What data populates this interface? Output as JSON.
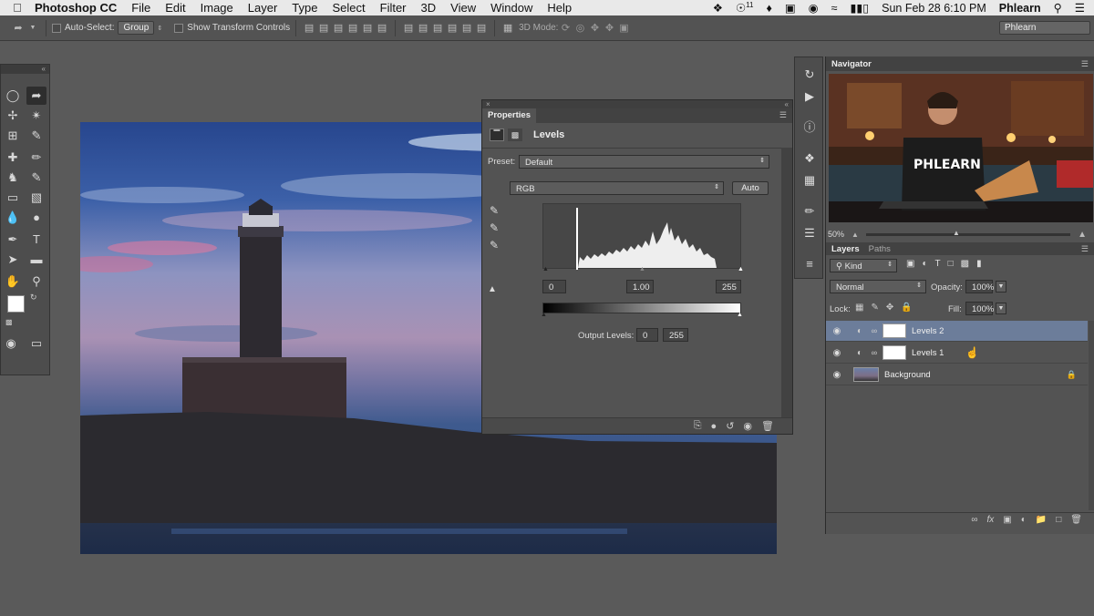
{
  "menubar": {
    "apple": "",
    "app_name": "Photoshop CC",
    "items": [
      "File",
      "Edit",
      "Image",
      "Layer",
      "Type",
      "Select",
      "Filter",
      "3D",
      "View",
      "Window",
      "Help"
    ],
    "status": {
      "notification_count": "11",
      "datetime": "Sun Feb 28  6:10 PM",
      "user": "Phlearn"
    }
  },
  "options_bar": {
    "auto_select_label": "Auto-Select:",
    "auto_select_value": "Group",
    "show_transform_label": "Show Transform Controls",
    "mode_3d_label": "3D Mode:",
    "workspace": "Phlearn"
  },
  "properties_panel": {
    "title": "Properties",
    "adjustment_name": "Levels",
    "preset_label": "Preset:",
    "preset_value": "Default",
    "channel_value": "RGB",
    "auto_label": "Auto",
    "input_black": "0",
    "input_gamma": "1.00",
    "input_white": "255",
    "output_label": "Output Levels:",
    "output_black": "0",
    "output_white": "255"
  },
  "navigator": {
    "title": "Navigator",
    "zoom": "50%",
    "shirt_text": "PHLEARN"
  },
  "layers_panel": {
    "tabs": [
      "Layers",
      "Paths"
    ],
    "filter_kind": "Kind",
    "blend_mode": "Normal",
    "opacity_label": "Opacity:",
    "opacity_value": "100%",
    "lock_label": "Lock:",
    "fill_label": "Fill:",
    "fill_value": "100%",
    "layers": [
      {
        "name": "Levels 2",
        "selected": true
      },
      {
        "name": "Levels 1",
        "selected": false
      },
      {
        "name": "Background",
        "selected": false
      }
    ]
  },
  "colors": {
    "panel_bg": "#535353",
    "selected_layer": "#6c7d9a",
    "menubar_bg": "#e9e9e9",
    "workspace_bg": "#5a5a5a"
  }
}
